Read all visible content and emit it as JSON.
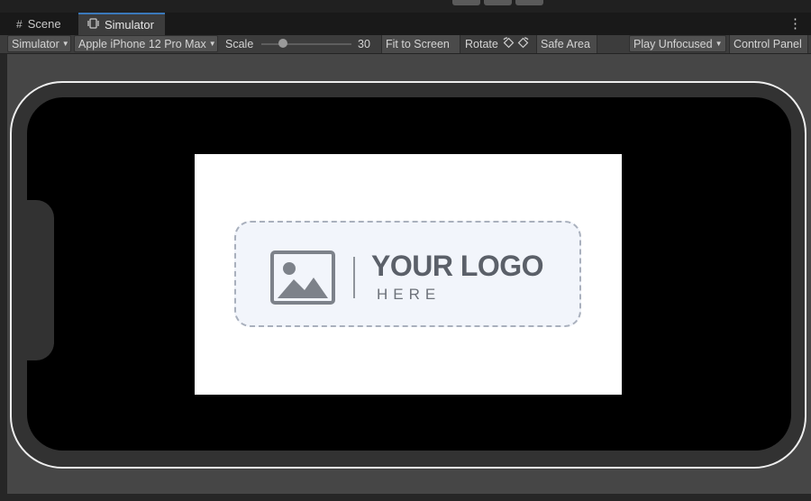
{
  "tabs": [
    {
      "label": "Scene",
      "icon": "grid-icon"
    },
    {
      "label": "Simulator",
      "icon": "device-icon"
    }
  ],
  "toolbar": {
    "simulator_dropdown": "Simulator",
    "device_dropdown": "Apple iPhone 12 Pro Max",
    "scale_label": "Scale",
    "scale_value": "30",
    "fit_to_screen": "Fit to Screen",
    "rotate": "Rotate",
    "safe_area": "Safe Area",
    "play_mode": "Play Unfocused",
    "control_panel": "Control Panel"
  },
  "logo": {
    "title": "YOUR LOGO",
    "subtitle": "HERE",
    "icon": "image-placeholder-icon"
  },
  "colors": {
    "accent": "#3a79bb",
    "tab_bg": "#191919",
    "toolbar_bg": "#3c3c3c",
    "logo_text": "#5b6069"
  }
}
